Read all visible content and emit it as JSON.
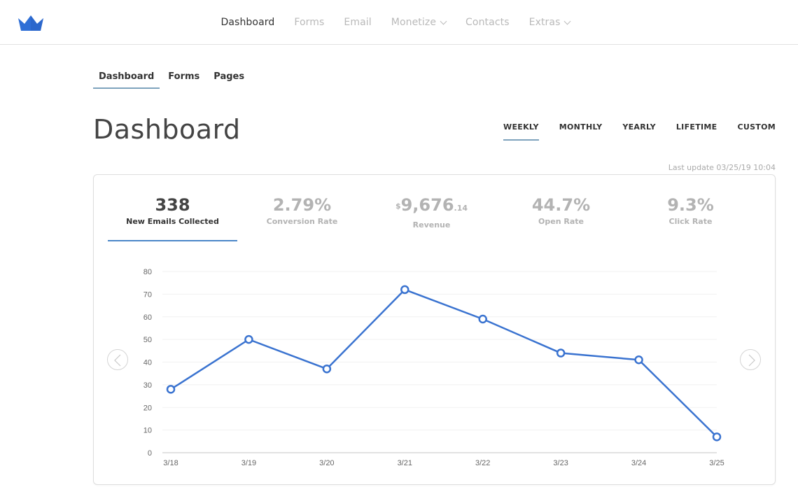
{
  "brand": {
    "color": "#2f6fd6",
    "logo_icon": "crown-icon"
  },
  "topnav": {
    "items": [
      {
        "label": "Dashboard",
        "active": true,
        "dropdown": false
      },
      {
        "label": "Forms",
        "active": false,
        "dropdown": false
      },
      {
        "label": "Email",
        "active": false,
        "dropdown": false
      },
      {
        "label": "Monetize",
        "active": false,
        "dropdown": true
      },
      {
        "label": "Contacts",
        "active": false,
        "dropdown": false
      },
      {
        "label": "Extras",
        "active": false,
        "dropdown": true
      }
    ]
  },
  "subtabs": [
    {
      "label": "Dashboard",
      "active": true
    },
    {
      "label": "Forms",
      "active": false
    },
    {
      "label": "Pages",
      "active": false
    }
  ],
  "page_title": "Dashboard",
  "period_tabs": [
    {
      "label": "WEEKLY",
      "active": true
    },
    {
      "label": "MONTHLY",
      "active": false
    },
    {
      "label": "YEARLY",
      "active": false
    },
    {
      "label": "LIFETIME",
      "active": false
    },
    {
      "label": "CUSTOM",
      "active": false
    }
  ],
  "last_update": "Last update 03/25/19 10:04",
  "stats": [
    {
      "value": "338",
      "label": "New Emails Collected",
      "active": true
    },
    {
      "value": "2.79%",
      "label": "Conversion Rate",
      "active": false
    },
    {
      "currency": "$",
      "value": "9,676",
      "cents": ".14",
      "label": "Revenue",
      "active": false
    },
    {
      "value": "44.7%",
      "label": "Open Rate",
      "active": false
    },
    {
      "value": "9.3%",
      "label": "Click Rate",
      "active": false
    }
  ],
  "nav_arrows": {
    "prev_icon": "chevron-left-icon",
    "next_icon": "chevron-right-icon"
  },
  "chart_data": {
    "type": "line",
    "title": "",
    "xlabel": "",
    "ylabel": "",
    "x": [
      "3/18",
      "3/19",
      "3/20",
      "3/21",
      "3/22",
      "3/23",
      "3/24",
      "3/25"
    ],
    "series": [
      {
        "name": "New Emails Collected",
        "values": [
          28,
          50,
          37,
          72,
          59,
          44,
          41,
          7
        ],
        "color": "#3a73d0"
      }
    ],
    "yticks": [
      0,
      10,
      20,
      30,
      40,
      50,
      60,
      70,
      80
    ],
    "ylim": [
      0,
      80
    ],
    "grid": true,
    "legend": "none"
  }
}
